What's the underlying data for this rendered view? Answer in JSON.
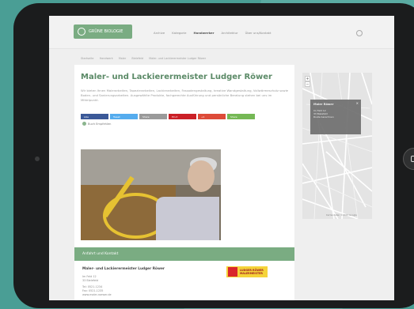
{
  "site": {
    "logo_text": "GRÜNE BIOLOGIE"
  },
  "nav": [
    "Archive",
    "Kategorie",
    "Handwerker",
    "Architektur",
    "Über uns/Kontakt"
  ],
  "nav_active_index": 2,
  "breadcrumb": [
    "Startseite",
    "Handwerk",
    "Maler",
    "Bielefeld",
    "Maler- und Lackierermeister Ludger Röwer"
  ],
  "page": {
    "title": "Maler- und Lackierermeister Ludger Röwer",
    "description": "Wir bieten Ihnen Malerarbeiten, Tapezierarbeiten, Lackierarbeiten, Fassadengestaltung, kreative Wandgestaltung, Vollwärmeschutz sowie Boden- und Sanierungsarbeiten. Ausgewählte Produkte, fachgerechte Ausführung und persönliche Beratung stehen bei uns im Mittelpunkt.",
    "share_buttons": [
      {
        "label": "Like",
        "color": "#3b5998"
      },
      {
        "label": "Tweet",
        "color": "#55acee"
      },
      {
        "label": "Share",
        "color": "#9a9a9a"
      },
      {
        "label": "Pin it",
        "color": "#cb2027"
      },
      {
        "label": "+1",
        "color": "#dd4b39"
      },
      {
        "label": "Share",
        "color": "#75b855"
      }
    ],
    "share_extra": "Buch Empfehlen"
  },
  "contact": {
    "heading": "Anfahrt und Kontakt",
    "name": "Maler- und Lackierermeister Ludger Röwer",
    "address": [
      "Im Feld 12",
      "33 Bielefeld"
    ],
    "phone": [
      "Tel: 0521-1234",
      "Fax: 0521-1235"
    ],
    "web": "www.maler-roewer.de",
    "badge_lines": [
      "LUDGER RÖWER",
      "MALERMEISTER"
    ]
  },
  "map": {
    "zoom_in": "+",
    "zoom_out": "−",
    "popup_title": "Maler Röwer",
    "popup_lines": [
      "Im Feld 12",
      "33 Bielefeld",
      "Route berechnen"
    ],
    "close": "×",
    "credit": "Kartendaten ©2015 Google"
  },
  "colors": {
    "brand_green": "#7aac82",
    "title_green": "#5b8a67",
    "background": "#4a9e95"
  }
}
